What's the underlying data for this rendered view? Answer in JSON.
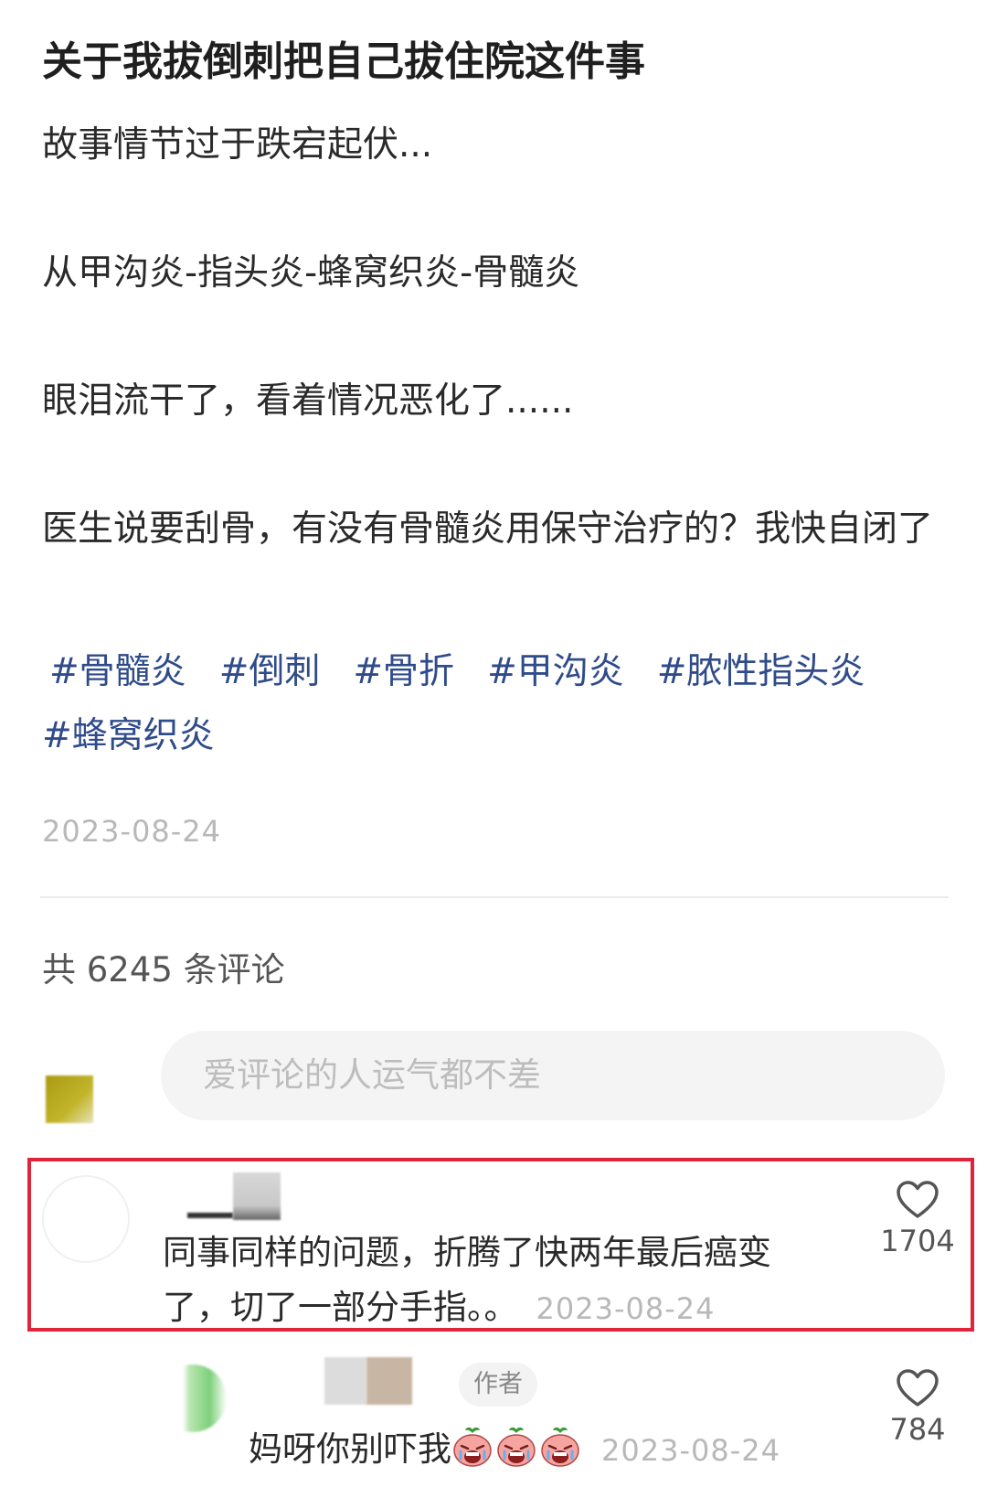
{
  "post": {
    "title": "关于我拔倒刺把自己拔住院这件事",
    "paragraphs": [
      "故事情节过于跌宕起伏...",
      "从甲沟炎-指头炎-蜂窝织炎-骨髓炎",
      "眼泪流干了，看着情况恶化了......",
      "医生说要刮骨，有没有骨髓炎用保守治疗的？我快自闭了"
    ],
    "tags": [
      "#骨髓炎",
      "#倒刺",
      "#骨折",
      "#甲沟炎",
      "#脓性指头炎",
      "#蜂窝织炎"
    ],
    "date": "2023-08-24"
  },
  "comments_section": {
    "count_label": "共 6245 条评论",
    "input_placeholder": "爱评论的人运气都不差"
  },
  "comments": [
    {
      "text": "同事同样的问题，折腾了快两年最后癌变了，切了一部分手指。。",
      "date": "2023-08-24",
      "likes": "1704",
      "highlighted": true,
      "highlight_color": "#e0253a"
    }
  ],
  "reply": {
    "badge": "作者",
    "text": "妈呀你别吓我",
    "emoji": [
      "crying-face-emoji",
      "crying-face-emoji",
      "crying-face-emoji"
    ],
    "date": "2023-08-24",
    "likes": "784"
  },
  "colors": {
    "tag": "#2f4b8a",
    "muted": "#b8b8b8",
    "highlight": "#e0253a"
  }
}
